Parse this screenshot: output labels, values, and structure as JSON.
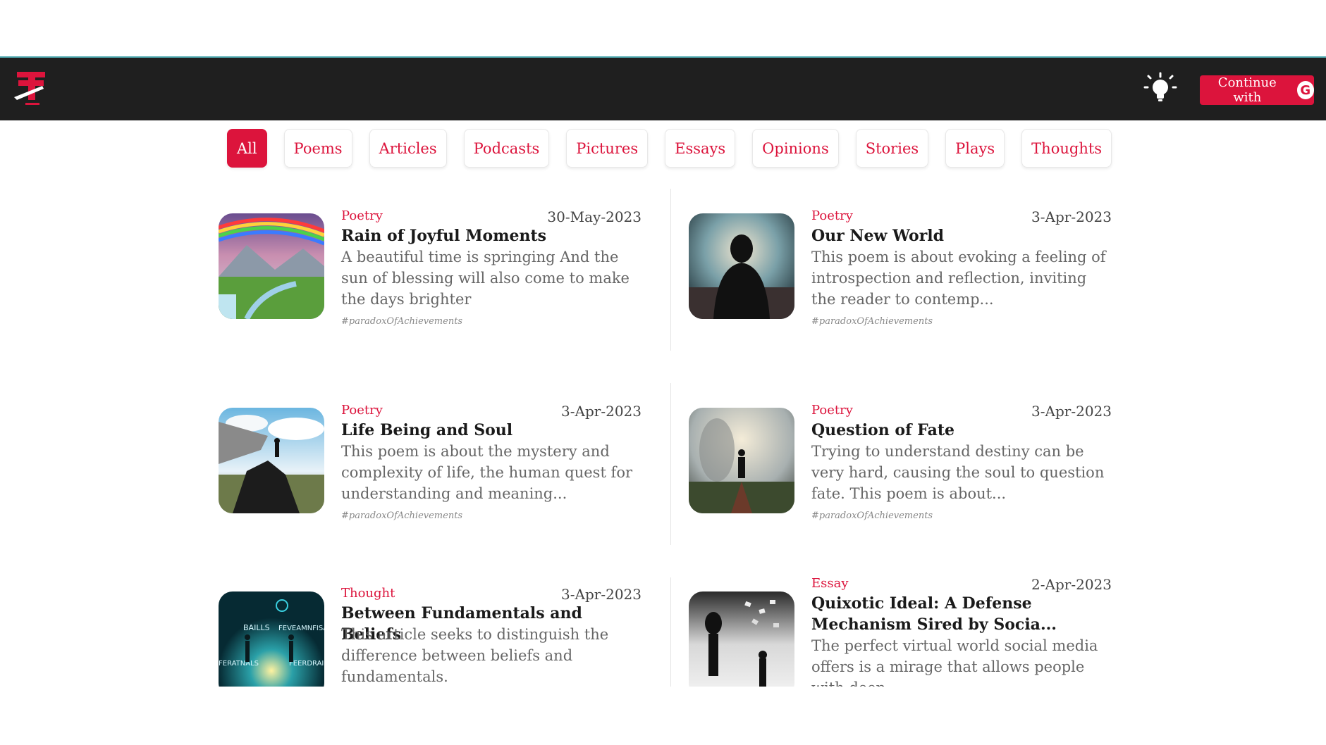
{
  "nav": {
    "logo_icon": "thrillsy-logo-icon",
    "theme_icon": "lightbulb-icon",
    "continue_label": "Continue with",
    "google_icon": "google-g-icon",
    "google_letter": "G"
  },
  "tabs": [
    "All",
    "Poems",
    "Articles",
    "Podcasts",
    "Pictures",
    "Essays",
    "Opinions",
    "Stories",
    "Plays",
    "Thoughts"
  ],
  "active_tab": "All",
  "posts": [
    {
      "category": "Poetry",
      "date": "30-May-2023",
      "title": "Rain of Joyful Moments",
      "excerpt": "A beautiful time is springing And the sun of blessing will also come to make the days brighter",
      "tag": "#paradoxOfAchievements"
    },
    {
      "category": "Poetry",
      "date": "3-Apr-2023",
      "title": "Our New World",
      "excerpt": "This poem is about evoking a feeling of introspection and reflection, inviting the reader to contemp...",
      "tag": "#paradoxOfAchievements"
    },
    {
      "category": "Poetry",
      "date": "3-Apr-2023",
      "title": "Life Being and Soul",
      "excerpt": "This poem is about the mystery and complexity of life, the human quest for understanding and meaning...",
      "tag": "#paradoxOfAchievements"
    },
    {
      "category": "Poetry",
      "date": "3-Apr-2023",
      "title": "Question of Fate",
      "excerpt": "Trying to understand destiny can be very hard, causing the soul to question fate. This poem is about...",
      "tag": "#paradoxOfAchievements"
    },
    {
      "category": "Thought",
      "date": "3-Apr-2023",
      "title": "Between Fundamentals and Beliefs",
      "excerpt": "This article seeks to distinguish the difference between beliefs and fundamentals.",
      "tag": "",
      "image_text": [
        "BAILLS",
        "FEVEAMNFISA",
        "FERATNALS",
        "FEERDRAI"
      ]
    },
    {
      "category": "Essay",
      "date": "2-Apr-2023",
      "title": "Quixotic Ideal: A Defense Mechanism Sired by Socia...",
      "excerpt": "The perfect virtual world social media offers is a mirage that allows people with deep",
      "tag": ""
    }
  ],
  "colors": {
    "accent": "#dc143c",
    "navbar": "#1f1f1f"
  }
}
